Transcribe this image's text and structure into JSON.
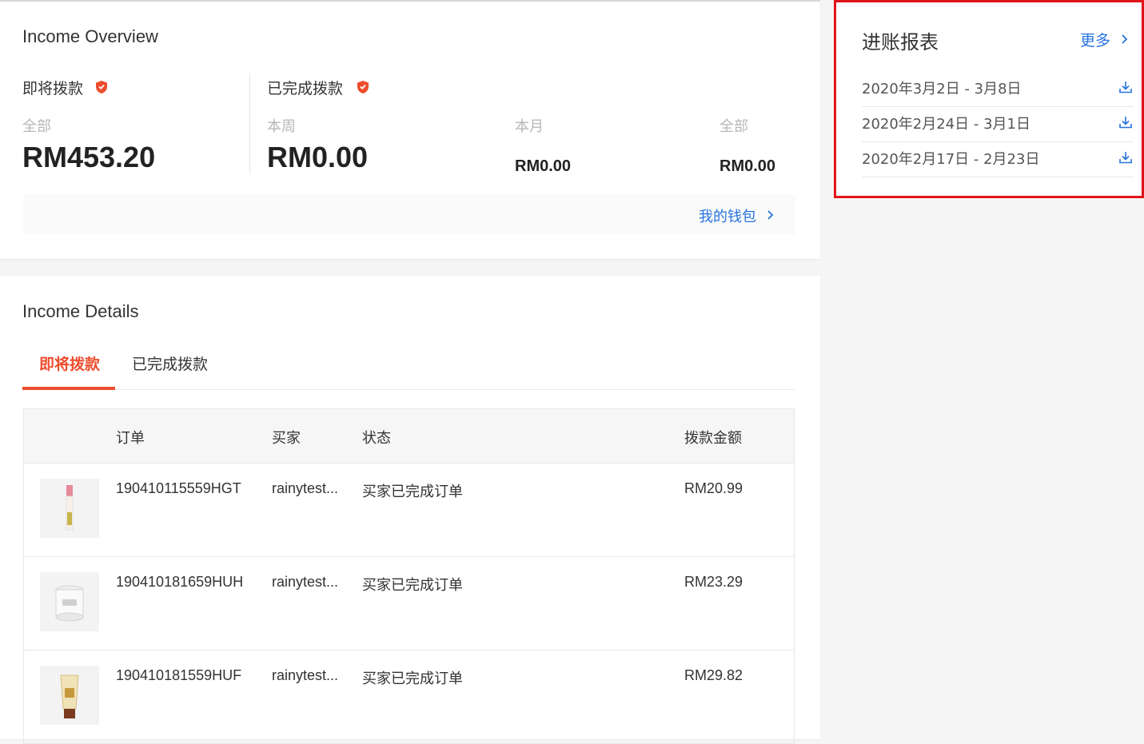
{
  "overview": {
    "title": "Income Overview",
    "pending": {
      "label": "即将拨款",
      "sub": "全部",
      "amount": "RM453.20"
    },
    "completed": {
      "label": "已完成拨款",
      "week_label": "本周",
      "week_amount": "RM0.00",
      "month_label": "本月",
      "month_amount": "RM0.00",
      "all_label": "全部",
      "all_amount": "RM0.00"
    },
    "wallet_link": "我的钱包"
  },
  "details": {
    "title": "Income Details",
    "tabs": [
      {
        "label": "即将拨款",
        "active": true
      },
      {
        "label": "已完成拨款",
        "active": false
      }
    ],
    "columns": [
      "订单",
      "买家",
      "状态",
      "拨款金额"
    ],
    "rows": [
      {
        "order": "190410115559HGT",
        "buyer": "rainytest...",
        "status": "买家已完成订单",
        "amount": "RM20.99",
        "thumb": "lipgloss-product"
      },
      {
        "order": "190410181659HUH",
        "buyer": "rainytest...",
        "status": "买家已完成订单",
        "amount": "RM23.29",
        "thumb": "cream-jar-product"
      },
      {
        "order": "190410181559HUF",
        "buyer": "rainytest...",
        "status": "买家已完成订单",
        "amount": "RM29.82",
        "thumb": "tube-product"
      }
    ]
  },
  "reports": {
    "title": "进账报表",
    "more": "更多",
    "items": [
      {
        "label": "2020年3月2日 - 3月8日"
      },
      {
        "label": "2020年2月24日 - 3月1日"
      },
      {
        "label": "2020年2月17日 - 2月23日"
      }
    ]
  },
  "colors": {
    "accent": "#ee4d2d",
    "link": "#2673dd",
    "highlight_border": "#e1131a"
  }
}
